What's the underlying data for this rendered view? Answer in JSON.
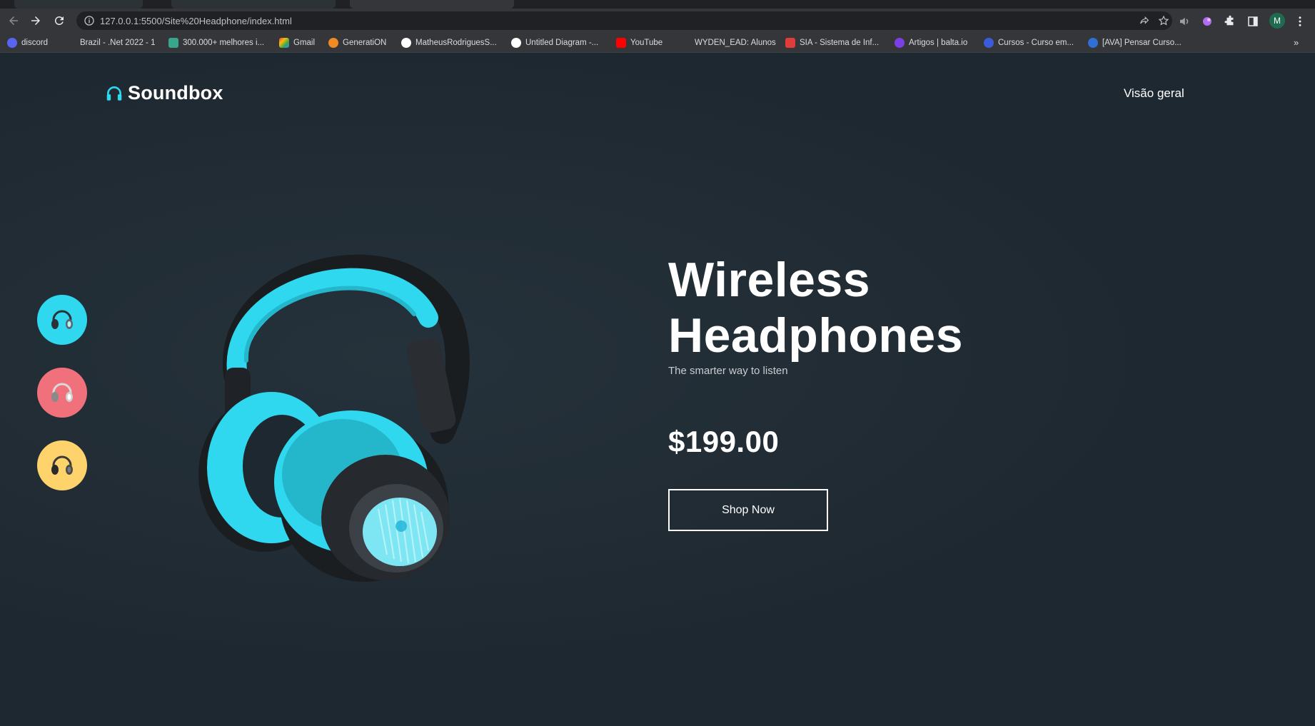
{
  "browser": {
    "url": "127.0.0.1:5500/Site%20Headphone/index.html",
    "profile_initial": "M",
    "bookmarks": [
      {
        "label": "discord",
        "icon": "discord-icon",
        "color": "#5865f2"
      },
      {
        "label": "Brazil - .Net 2022 - 1",
        "icon": "dotnet-icon",
        "color": "#35363a"
      },
      {
        "label": "300.000+ melhores i...",
        "icon": "d-icon",
        "color": "#3aa58d"
      },
      {
        "label": "Gmail",
        "icon": "gmail-icon",
        "color": "#ea4335"
      },
      {
        "label": "GeneratiON",
        "icon": "generation-icon",
        "color": "#f08a24"
      },
      {
        "label": "MatheusRodriguesS...",
        "icon": "github-icon",
        "color": "#ffffff"
      },
      {
        "label": "Untitled Diagram -...",
        "icon": "diagram-icon",
        "color": "#ffffff"
      },
      {
        "label": "YouTube",
        "icon": "youtube-icon",
        "color": "#ff0000"
      },
      {
        "label": "WYDEN_EAD: Alunos",
        "icon": "wyden-icon",
        "color": "#35363a"
      },
      {
        "label": "SIA - Sistema de Inf...",
        "icon": "sia-icon",
        "color": "#e03c3c"
      },
      {
        "label": "Artigos | balta.io",
        "icon": "balta-icon",
        "color": "#7b3fe4"
      },
      {
        "label": "Cursos - Curso em...",
        "icon": "curso-icon",
        "color": "#3b5bdb"
      },
      {
        "label": "[AVA] Pensar Curso...",
        "icon": "ava-icon",
        "color": "#2f6fd6"
      }
    ]
  },
  "site": {
    "brand": "Soundbox",
    "nav_link": "Visão geral",
    "thumbnails": [
      {
        "name": "cyan",
        "color": "#2fd8ee"
      },
      {
        "name": "pink",
        "color": "#f0707c"
      },
      {
        "name": "yellow",
        "color": "#ffd36b"
      }
    ],
    "hero": {
      "title_line1": "Wireless",
      "title_line2": "Headphones",
      "subtitle": "The smarter way to listen",
      "price": "$199.00",
      "cta": "Shop Now"
    }
  }
}
